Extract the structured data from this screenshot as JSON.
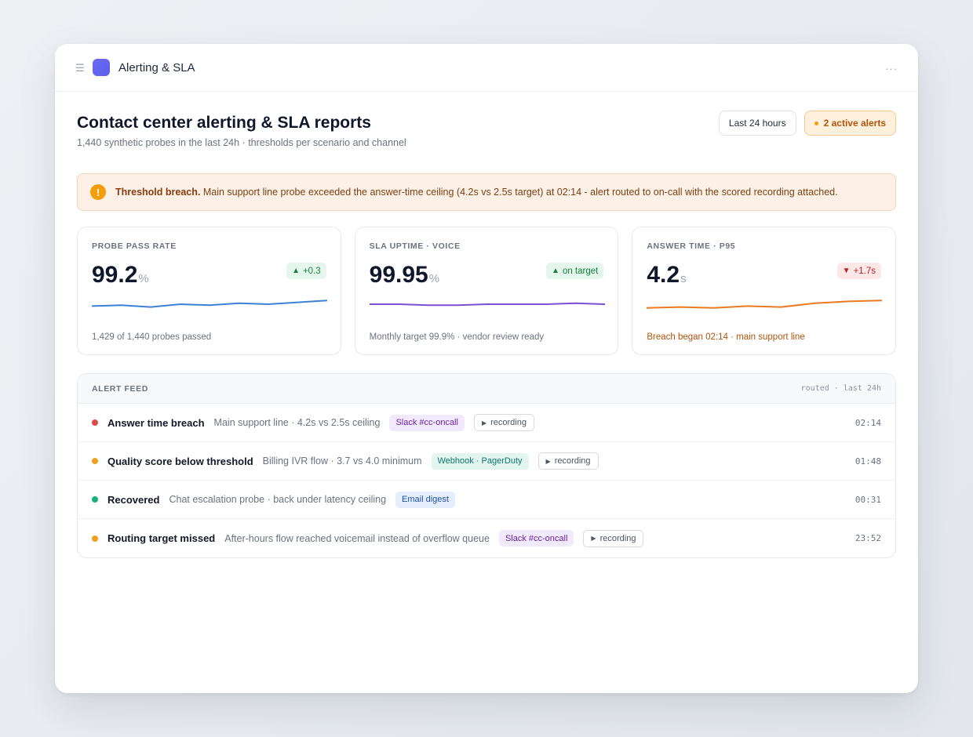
{
  "app": {
    "title": "Alerting & SLA"
  },
  "page": {
    "title": "Contact center alerting & SLA reports",
    "subtitle": "1,440 synthetic probes in the last 24h · thresholds per scenario and channel",
    "range_label": "Last 24 hours",
    "alerts_label": "2 active alerts"
  },
  "banner": {
    "strong": "Threshold breach.",
    "text": " Main support line probe exceeded the answer-time ceiling (4.2s vs 2.5s target) at 02:14 - alert routed to on-call with the scored recording attached."
  },
  "cards": [
    {
      "label": "PROBE PASS RATE",
      "value": "99.2",
      "unit": "%",
      "delta": "+0.3",
      "delta_dir": "up",
      "foot": "1,429 of 1,440 probes passed",
      "color": "#3b82d6",
      "spark": [
        0.4,
        0.45,
        0.35,
        0.5,
        0.45,
        0.55,
        0.5,
        0.6,
        0.7
      ]
    },
    {
      "label": "SLA UPTIME · VOICE",
      "value": "99.95",
      "unit": "%",
      "delta": "on target",
      "delta_dir": "up",
      "foot": "Monthly target 99.9% · vendor review ready",
      "color": "#7c4dd6",
      "spark": [
        0.5,
        0.5,
        0.45,
        0.45,
        0.5,
        0.5,
        0.5,
        0.55,
        0.5
      ]
    },
    {
      "label": "ANSWER TIME · P95",
      "value": "4.2",
      "unit": "s",
      "delta": "+1.7s",
      "delta_dir": "down",
      "foot": "Breach began 02:14 · main support line",
      "color": "#ea7a1f",
      "spark": [
        0.3,
        0.35,
        0.3,
        0.4,
        0.35,
        0.55,
        0.65,
        0.7
      ]
    }
  ],
  "feed": {
    "title": "ALERT FEED",
    "meta": "routed · last 24h",
    "rows": [
      {
        "status_color": "#dc4a4a",
        "title": "Answer time breach",
        "desc": "Main support line · 4.2s vs 2.5s ceiling",
        "tag": "Slack #cc-oncall",
        "tag_kind": "slack",
        "recording": "recording",
        "time": "02:14"
      },
      {
        "status_color": "#f0a020",
        "title": "Quality score below threshold",
        "desc": "Billing IVR flow · 3.7 vs 4.0 minimum",
        "tag": "Webhook · PagerDuty",
        "tag_kind": "webhook",
        "recording": "recording",
        "time": "01:48"
      },
      {
        "status_color": "#16b07a",
        "title": "Recovered",
        "desc": "Chat escalation probe · back under latency ceiling",
        "tag": "Email digest",
        "tag_kind": "email",
        "recording": "",
        "time": "00:31"
      },
      {
        "status_color": "#f0a020",
        "title": "Routing target missed",
        "desc": "After-hours flow reached voicemail instead of overflow queue",
        "tag": "Slack #cc-oncall",
        "tag_kind": "slack",
        "recording": "recording",
        "time": "23:52"
      }
    ]
  }
}
